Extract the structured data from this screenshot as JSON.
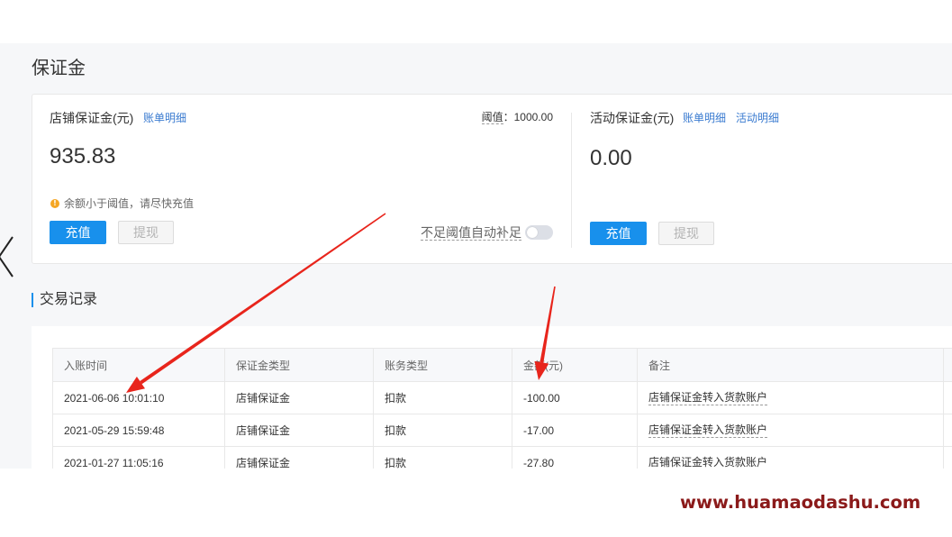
{
  "page": {
    "title": "保证金"
  },
  "store_deposit": {
    "label": "店铺保证金(元)",
    "bill_link": "账单明细",
    "threshold_label": "阈值",
    "threshold_sep": "：",
    "threshold_value": "1000.00",
    "balance": "935.83",
    "warning_glyph": "!",
    "warning": "余额小于阈值，请尽快充值",
    "recharge_button": "充值",
    "withdraw_button": "提现",
    "auto_topup_label": "不足阈值自动补足",
    "auto_topup_on": false
  },
  "activity_deposit": {
    "label": "活动保证金(元)",
    "bill_link": "账单明细",
    "activity_link": "活动明细",
    "balance": "0.00",
    "recharge_button": "充值",
    "withdraw_button": "提现"
  },
  "transactions": {
    "title": "交易记录",
    "columns": [
      "入账时间",
      "保证金类型",
      "账务类型",
      "金额(元)",
      "备注"
    ],
    "rows": [
      {
        "time": "2021-06-06 10:01:10",
        "deposit_type": "店铺保证金",
        "entry_type": "扣款",
        "amount": "-100.00",
        "remark": "店铺保证金转入货款账户"
      },
      {
        "time": "2021-05-29 15:59:48",
        "deposit_type": "店铺保证金",
        "entry_type": "扣款",
        "amount": "-17.00",
        "remark": "店铺保证金转入货款账户"
      },
      {
        "time": "2021-01-27 11:05:16",
        "deposit_type": "店铺保证金",
        "entry_type": "扣款",
        "amount": "-27.80",
        "remark": "店铺保证金转入货款账户"
      }
    ]
  },
  "watermark": "www.huamaodashu.com",
  "colors": {
    "primary": "#1890ec",
    "link": "#3a7bd0",
    "warning": "#f5a623",
    "annotation_arrow": "#e8251c",
    "watermark": "#8b1a1a",
    "page_background": "#f6f7f9"
  },
  "icons": {
    "warning": "warning-icon",
    "carousel_prev": "chevron-left-icon"
  }
}
